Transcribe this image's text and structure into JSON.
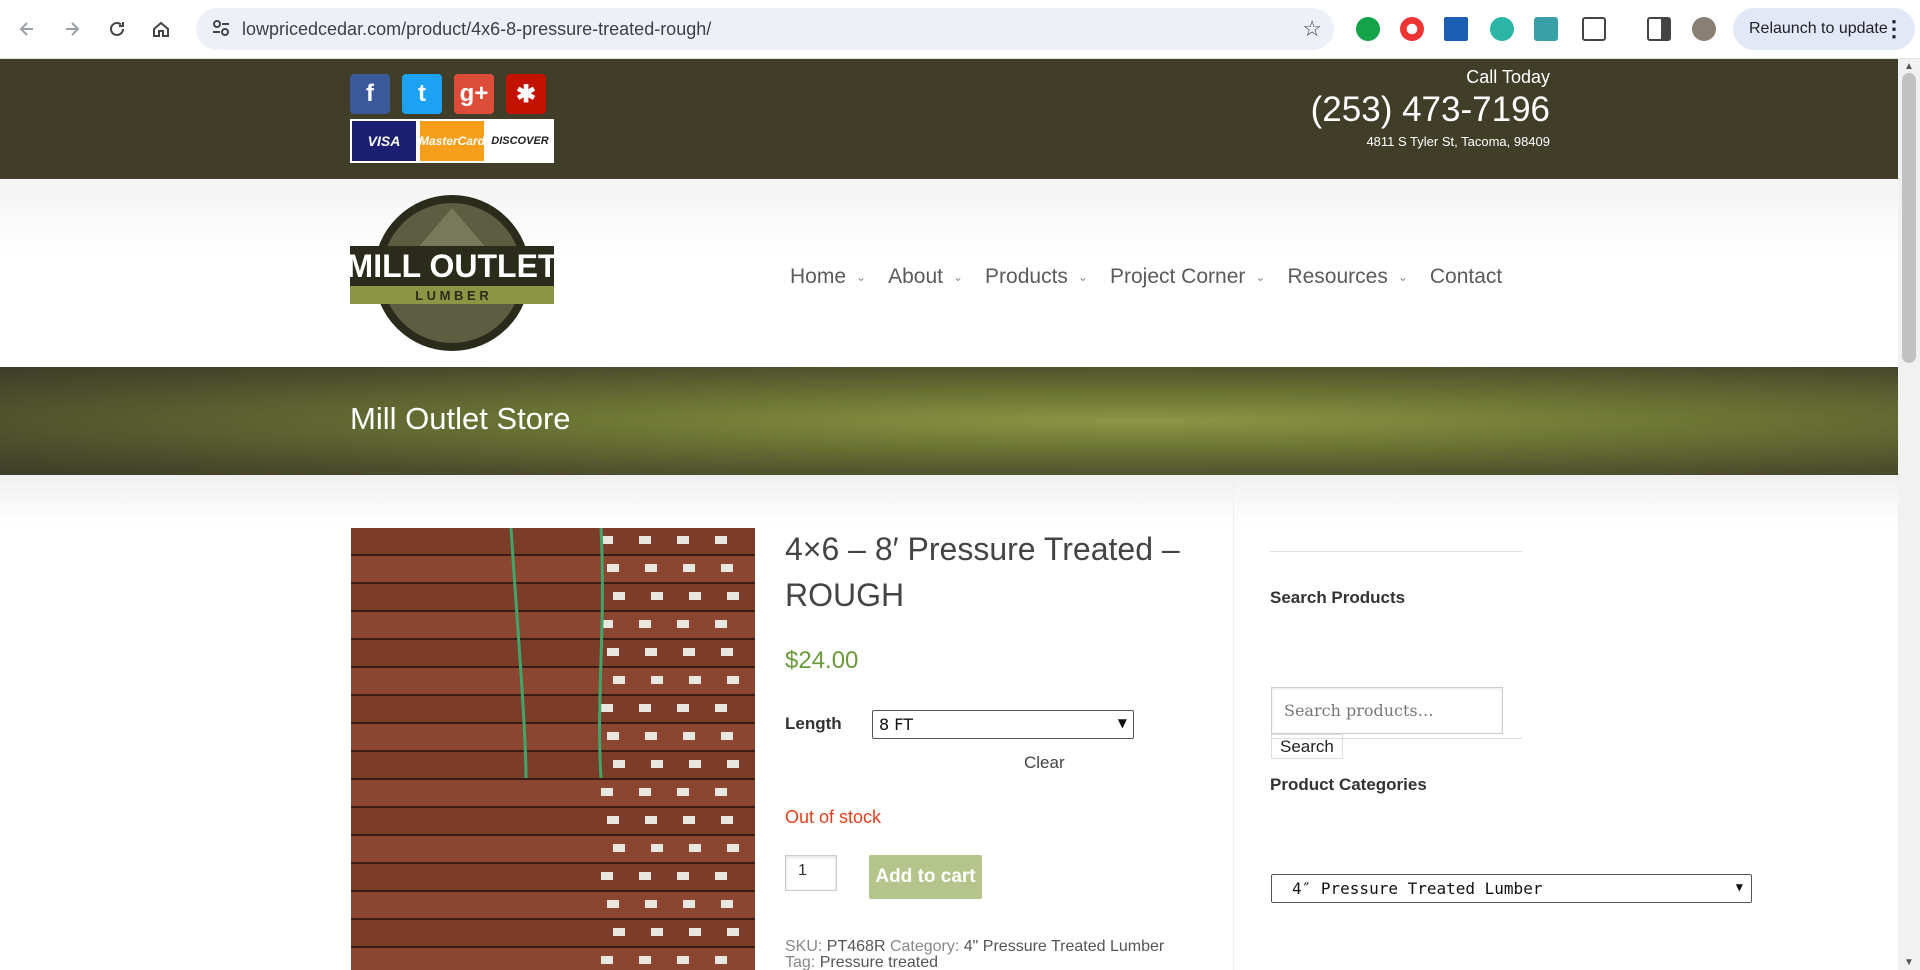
{
  "browser": {
    "url": "lowpricedcedar.com/product/4x6-8-pressure-treated-rough/",
    "relaunch_label": "Relaunch to update"
  },
  "topbar": {
    "social": [
      {
        "name": "facebook-icon",
        "glyph": "f",
        "color": "#3b5998"
      },
      {
        "name": "twitter-icon",
        "glyph": "t",
        "color": "#1da1f2"
      },
      {
        "name": "google-plus-icon",
        "glyph": "g+",
        "color": "#dd4b39"
      },
      {
        "name": "yelp-icon",
        "glyph": "✱",
        "color": "#c41200"
      }
    ],
    "cards": [
      "VISA",
      "MasterCard",
      "DISCOVER"
    ],
    "call_label": "Call Today",
    "phone": "(253) 473-7196",
    "address": "4811 S Tyler St, Tacoma, 98409"
  },
  "header": {
    "logo_text": "MILL OUTLET",
    "logo_sub": "L U M B E R",
    "menu": [
      {
        "label": "Home",
        "has_dropdown": true
      },
      {
        "label": "About",
        "has_dropdown": true
      },
      {
        "label": "Products",
        "has_dropdown": true
      },
      {
        "label": "Project Corner",
        "has_dropdown": true
      },
      {
        "label": "Resources",
        "has_dropdown": true
      },
      {
        "label": "Contact",
        "has_dropdown": false
      }
    ]
  },
  "banner": {
    "title": "Mill Outlet Store"
  },
  "product": {
    "title": "4×6 – 8′ Pressure Treated – ROUGH",
    "price": "$24.00",
    "length_label": "Length",
    "length_value": "8 FT",
    "clear_label": "Clear",
    "stock_status": "Out of stock",
    "quantity": "1",
    "add_to_cart_label": "Add to cart",
    "sku_label": "SKU:",
    "sku": "PT468R",
    "category_label": "Category:",
    "category": "4\" Pressure Treated Lumber",
    "tag_label": "Tag:",
    "tag": "Pressure treated"
  },
  "sidebar": {
    "search_title": "Search Products",
    "search_placeholder": "Search products…",
    "search_button": "Search",
    "categories_title": "Product Categories",
    "categories_value": "4″ Pressure Treated Lumber"
  },
  "colors": {
    "topbar": "#403e28",
    "banner_accent": "#8b9645",
    "price": "#6a9a3a",
    "out_of_stock": "#e2401c",
    "add_to_cart": "#b4c48b"
  }
}
